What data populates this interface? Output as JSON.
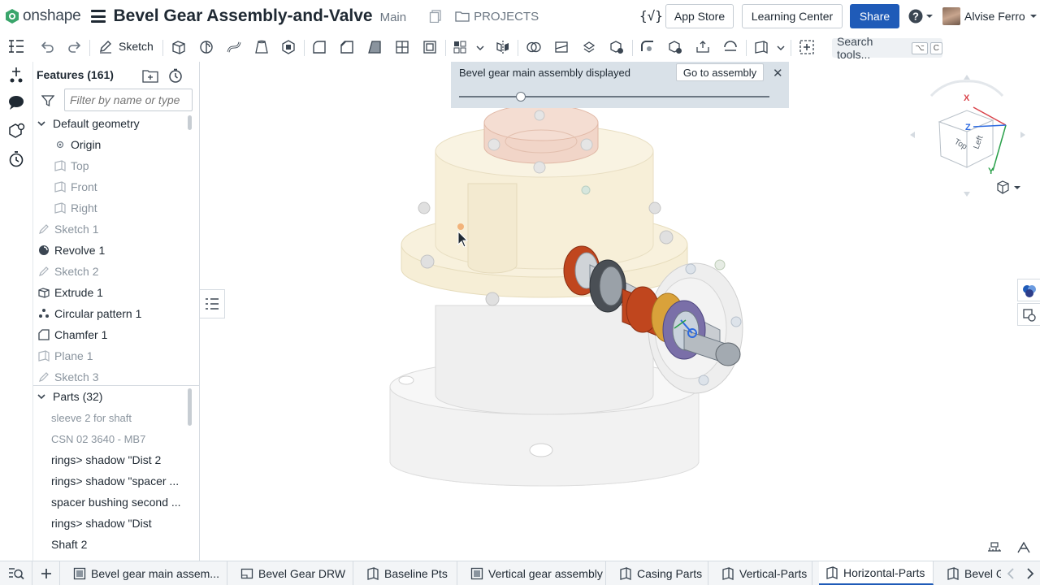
{
  "header": {
    "logo_text": "onshape",
    "doc_title": "Bevel Gear Assembly-and-Valve",
    "workspace": "Main",
    "projects_label": "PROJECTS",
    "variables_symbol": "{√}",
    "app_store_label": "App Store",
    "learning_center_label": "Learning Center",
    "share_label": "Share",
    "user_name": "Alvise Ferro"
  },
  "toolbar": {
    "sketch_label": "Sketch",
    "search_label": "Search tools...",
    "search_shortcut": [
      "⌥",
      "C"
    ]
  },
  "panel": {
    "title": "Features (161)",
    "filter_placeholder": "Filter by name or type",
    "features": [
      {
        "label": "Default geometry",
        "type": "group",
        "dim": false
      },
      {
        "label": "Origin",
        "type": "origin",
        "dim": false
      },
      {
        "label": "Top",
        "type": "plane",
        "dim": true
      },
      {
        "label": "Front",
        "type": "plane",
        "dim": true
      },
      {
        "label": "Right",
        "type": "plane",
        "dim": true
      },
      {
        "label": "Sketch 1",
        "type": "sketch",
        "dim": true
      },
      {
        "label": "Revolve 1",
        "type": "revolve",
        "dim": false
      },
      {
        "label": "Sketch 2",
        "type": "sketch",
        "dim": true
      },
      {
        "label": "Extrude 1",
        "type": "extrude",
        "dim": false
      },
      {
        "label": "Circular pattern 1",
        "type": "pattern",
        "dim": false
      },
      {
        "label": "Chamfer 1",
        "type": "chamfer",
        "dim": false
      },
      {
        "label": "Plane 1",
        "type": "plane",
        "dim": true
      },
      {
        "label": "Sketch 3",
        "type": "sketch",
        "dim": true
      }
    ],
    "parts_title": "Parts (32)",
    "parts": [
      {
        "label": "sleeve 2 for shaft",
        "dim": true
      },
      {
        "label": "CSN 02 3640 - MB7",
        "dim": true
      },
      {
        "label": "rings> shadow \"Dist 2",
        "dim": false
      },
      {
        "label": "rings> shadow \"spacer ...",
        "dim": false
      },
      {
        "label": "spacer bushing second ...",
        "dim": false
      },
      {
        "label": "rings> shadow \"Dist",
        "dim": false
      },
      {
        "label": "Shaft 2",
        "dim": false
      }
    ]
  },
  "viewport": {
    "notice_text": "Bevel gear main assembly displayed",
    "goto_label": "Go to assembly",
    "close_symbol": "✕",
    "transparency_fraction": 0.2,
    "view_cube": {
      "top_label": "Top",
      "left_label": "Left",
      "axis_x": "X",
      "axis_y": "Y",
      "axis_z": "Z"
    }
  },
  "tabs": [
    {
      "label": "Bevel gear main assem...",
      "type": "assembly",
      "active": false
    },
    {
      "label": "Bevel Gear DRW",
      "type": "drawing",
      "active": false
    },
    {
      "label": "Baseline Pts",
      "type": "partstudio",
      "active": false
    },
    {
      "label": "Vertical gear assembly",
      "type": "assembly",
      "active": false
    },
    {
      "label": "Casing Parts",
      "type": "partstudio",
      "active": false
    },
    {
      "label": "Vertical-Parts",
      "type": "partstudio",
      "active": false
    },
    {
      "label": "Horizontal-Parts",
      "type": "partstudio",
      "active": true
    },
    {
      "label": "Bevel Gear",
      "type": "partstudio",
      "active": false
    }
  ],
  "colors": {
    "accent": "#1f5bb8",
    "casing": "#f5ecd3",
    "shaft_red": "#c0461e",
    "gear_gold": "#d9a23a"
  }
}
